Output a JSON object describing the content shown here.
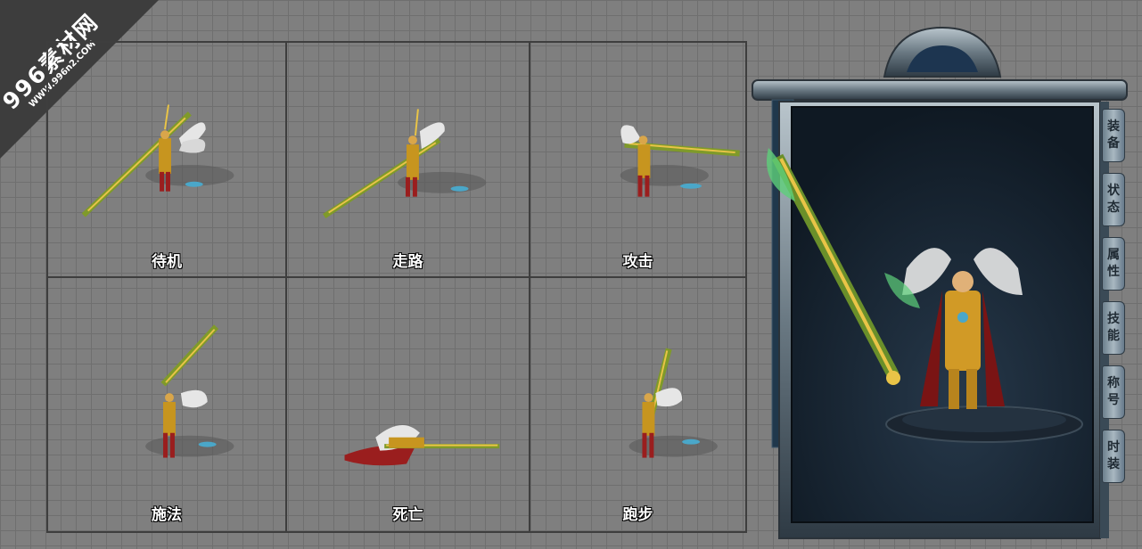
{
  "watermark": {
    "main": "996素材网",
    "sub": "WWW.996n2.COM"
  },
  "animations": [
    {
      "id": "idle",
      "label": "待机"
    },
    {
      "id": "walk",
      "label": "走路"
    },
    {
      "id": "attack",
      "label": "攻击"
    },
    {
      "id": "cast",
      "label": "施法"
    },
    {
      "id": "death",
      "label": "死亡"
    },
    {
      "id": "run",
      "label": "跑步"
    }
  ],
  "panel": {
    "tabs": [
      {
        "top": "装",
        "bottom": "备"
      },
      {
        "top": "状",
        "bottom": "态"
      },
      {
        "top": "属",
        "bottom": "性"
      },
      {
        "top": "技",
        "bottom": "能"
      },
      {
        "top": "称",
        "bottom": "号"
      },
      {
        "top": "时",
        "bottom": "装"
      }
    ]
  },
  "colors": {
    "gold": "#e9c447",
    "jade": "#5ed07a",
    "crimson": "#9a1e1e",
    "steel": "#8d9aa5",
    "panel_dark": "#1a2a38"
  }
}
